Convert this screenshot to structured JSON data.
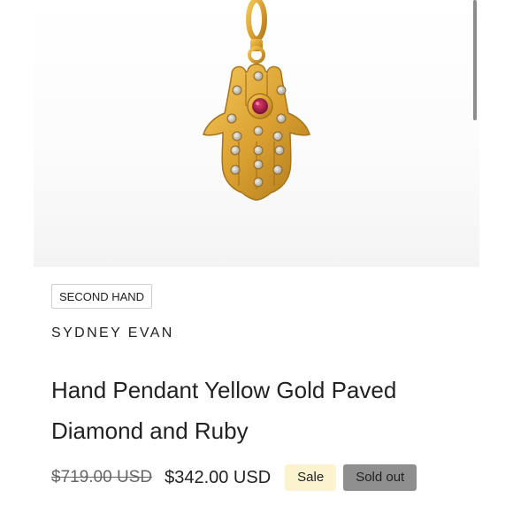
{
  "product": {
    "condition_badge": "SECOND HAND",
    "vendor": "SYDNEY EVAN",
    "title": "Hand Pendant Yellow Gold Paved Diamond and Ruby",
    "compare_price": "$719.00 USD",
    "price": "$342.00 USD",
    "sale_badge": "Sale",
    "availability_badge": "Sold out"
  },
  "icons": {
    "product_image": "hamsa-hand-pendant-image"
  },
  "colors": {
    "gold": "#d9a437",
    "ruby": "#c2185b",
    "sale_badge_bg": "#fbf3d0",
    "soldout_badge_bg": "#8f8f8f"
  }
}
